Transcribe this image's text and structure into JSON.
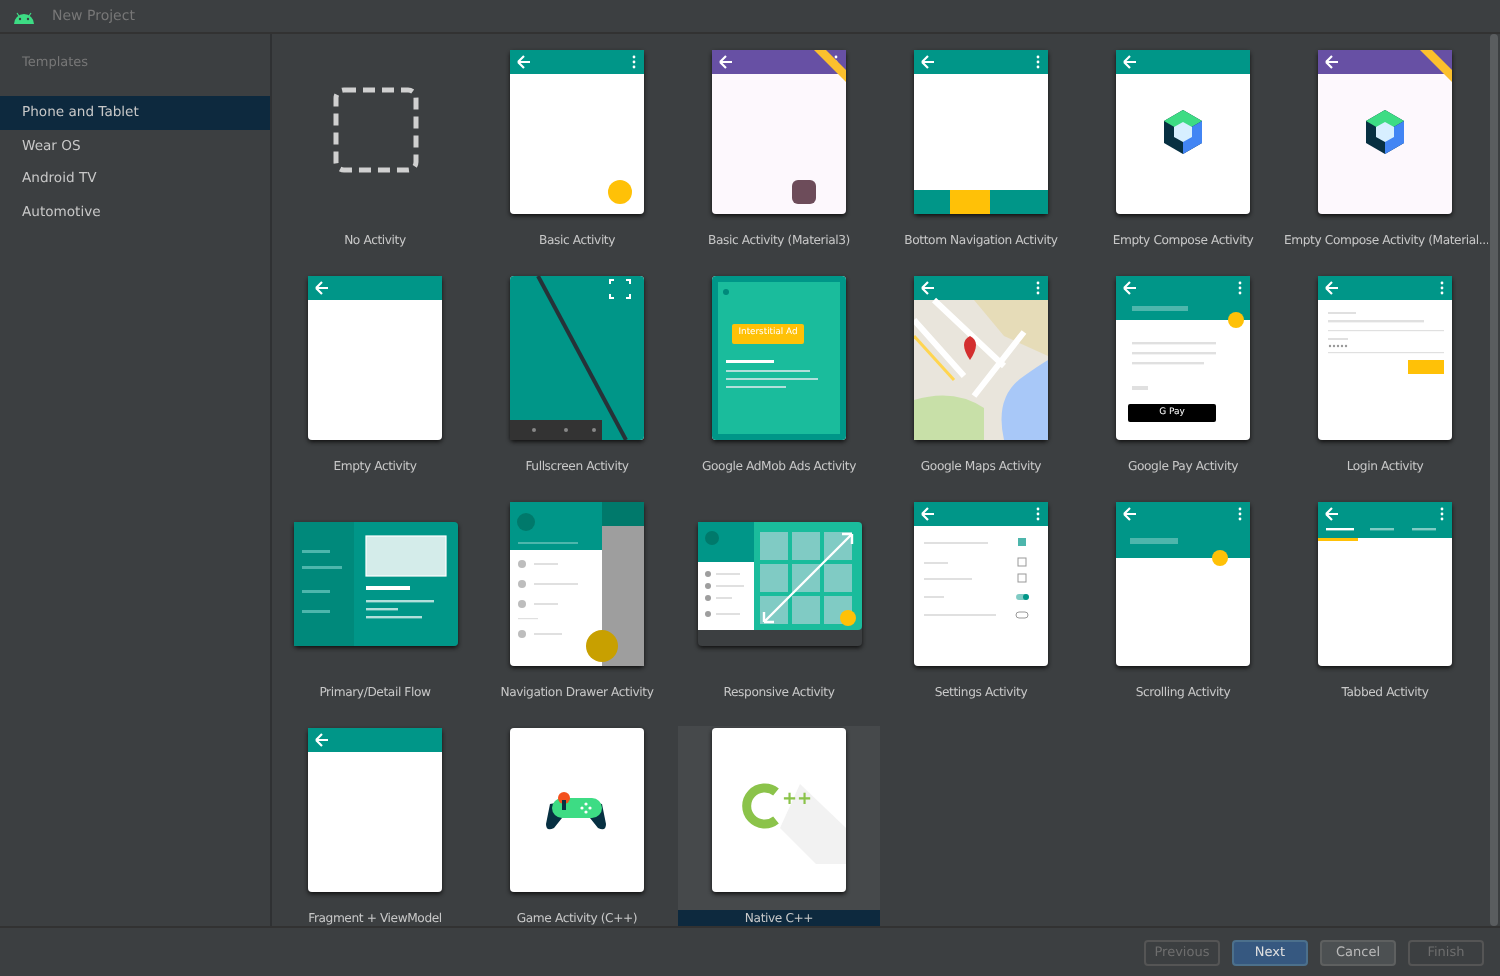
{
  "window": {
    "title": "New Project"
  },
  "sidebar": {
    "heading": "Templates",
    "items": [
      {
        "label": "Phone and Tablet",
        "selected": true
      },
      {
        "label": "Wear OS",
        "selected": false
      },
      {
        "label": "Android TV",
        "selected": false
      },
      {
        "label": "Automotive",
        "selected": false
      }
    ]
  },
  "templates": [
    {
      "label": "No Activity",
      "kind": "none",
      "selected": false
    },
    {
      "label": "Basic Activity",
      "kind": "basic",
      "selected": false
    },
    {
      "label": "Basic Activity (Material3)",
      "kind": "material3",
      "selected": false,
      "preview": true
    },
    {
      "label": "Bottom Navigation Activity",
      "kind": "bottomnav",
      "selected": false
    },
    {
      "label": "Empty Compose Activity",
      "kind": "compose",
      "selected": false
    },
    {
      "label": "Empty Compose Activity (Material...",
      "kind": "compose3",
      "selected": false,
      "preview": true
    },
    {
      "label": "Empty Activity",
      "kind": "plain",
      "selected": false
    },
    {
      "label": "Fullscreen Activity",
      "kind": "fullscreen",
      "selected": false
    },
    {
      "label": "Google AdMob Ads Activity",
      "kind": "admob",
      "selected": false,
      "text": "Interstitial Ad"
    },
    {
      "label": "Google Maps Activity",
      "kind": "maps",
      "selected": false
    },
    {
      "label": "Google Pay Activity",
      "kind": "pay",
      "selected": false,
      "text": "G Pay"
    },
    {
      "label": "Login Activity",
      "kind": "login",
      "selected": false
    },
    {
      "label": "Primary/Detail Flow",
      "kind": "detail",
      "selected": false
    },
    {
      "label": "Navigation Drawer Activity",
      "kind": "drawer",
      "selected": false
    },
    {
      "label": "Responsive Activity",
      "kind": "responsive",
      "selected": false
    },
    {
      "label": "Settings Activity",
      "kind": "settings",
      "selected": false
    },
    {
      "label": "Scrolling Activity",
      "kind": "scrolling",
      "selected": false
    },
    {
      "label": "Tabbed Activity",
      "kind": "tabbed",
      "selected": false
    },
    {
      "label": "Fragment + ViewModel",
      "kind": "plain",
      "selected": false
    },
    {
      "label": "Game Activity (C++)",
      "kind": "game",
      "selected": false
    },
    {
      "label": "Native C++",
      "kind": "cpp",
      "selected": true,
      "text": "++"
    }
  ],
  "buttons": [
    {
      "label": "Previous",
      "kind": "secondary",
      "disabled": true
    },
    {
      "label": "Next",
      "kind": "primary",
      "disabled": false
    },
    {
      "label": "Cancel",
      "kind": "secondary",
      "disabled": false
    },
    {
      "label": "Finish",
      "kind": "secondary",
      "disabled": true
    }
  ]
}
